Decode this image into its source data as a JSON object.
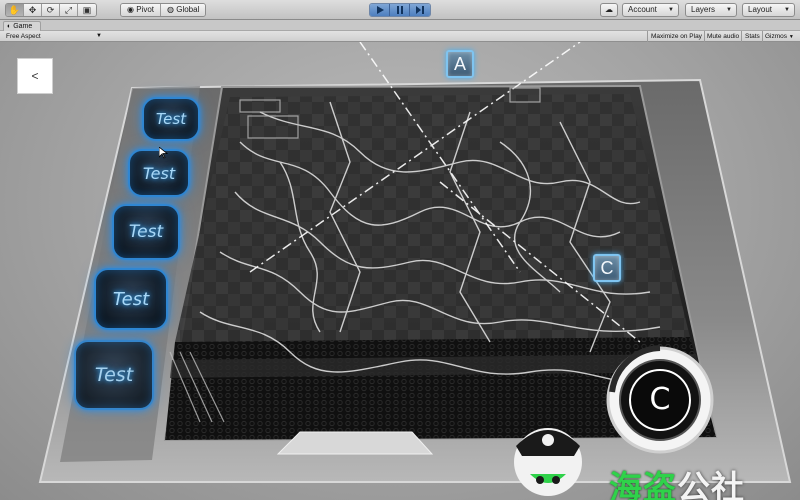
{
  "toolbar": {
    "tools": [
      "hand-tool",
      "move-tool",
      "rotate-tool",
      "scale-tool",
      "rect-tool"
    ],
    "pivot_label": "Pivot",
    "global_label": "Global",
    "account_label": "Account",
    "layers_label": "Layers",
    "layout_label": "Layout"
  },
  "game_view": {
    "tab_label": "Game",
    "aspect_label": "Free Aspect",
    "maximize_label": "Maximize on Play",
    "mute_label": "Mute audio",
    "stats_label": "Stats",
    "gizmos_label": "Gizmos"
  },
  "scene": {
    "back_label": "<",
    "test_buttons": [
      "Test",
      "Test",
      "Test",
      "Test",
      "Test"
    ],
    "marker_a": "A",
    "marker_c": "C",
    "joystick_label": "C"
  },
  "watermark": {
    "part1": "海盗",
    "part2": "公社"
  },
  "colors": {
    "accent_blue": "#2f86d2",
    "watermark_green": "#2fd24a"
  }
}
